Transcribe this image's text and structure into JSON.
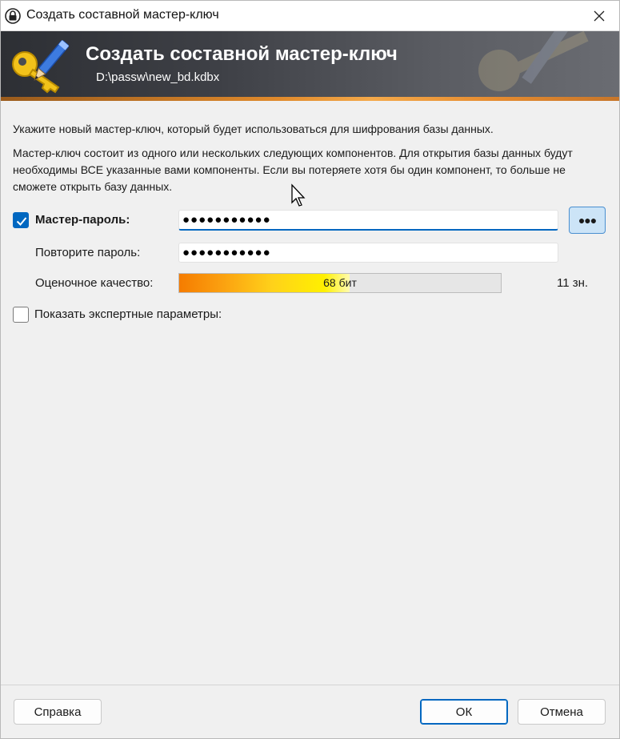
{
  "window": {
    "title": "Создать составной мастер-ключ"
  },
  "banner": {
    "heading": "Создать составной мастер-ключ",
    "path": "D:\\passw\\new_bd.kdbx"
  },
  "description": {
    "line1": "Укажите новый мастер-ключ, который будет использоваться для шифрования базы данных.",
    "line2": "Мастер-ключ состоит из одного или нескольких следующих компонентов. Для открытия базы данных будут необходимы ВСЕ указанные вами компоненты. Если вы потеряете хотя бы один компонент, то больше не сможете открыть базу данных."
  },
  "master_password": {
    "enabled": true,
    "label": "Мастер-пароль:",
    "value": "●●●●●●●●●●●",
    "toggle_label": "●●●"
  },
  "repeat_password": {
    "label": "Повторите пароль:",
    "value": "●●●●●●●●●●●"
  },
  "quality": {
    "label": "Оценочное качество:",
    "bar_text": "68 бит",
    "fill_fraction": 0.53,
    "length_text": "11 зн."
  },
  "expert": {
    "checked": false,
    "label": "Показать экспертные параметры:"
  },
  "buttons": {
    "help": "Справка",
    "ok": "ОК",
    "cancel": "Отмена"
  },
  "colors": {
    "accent": "#0067c0",
    "banner_dark": "#2d2f34",
    "banner_stripe": "#e08a2c"
  }
}
